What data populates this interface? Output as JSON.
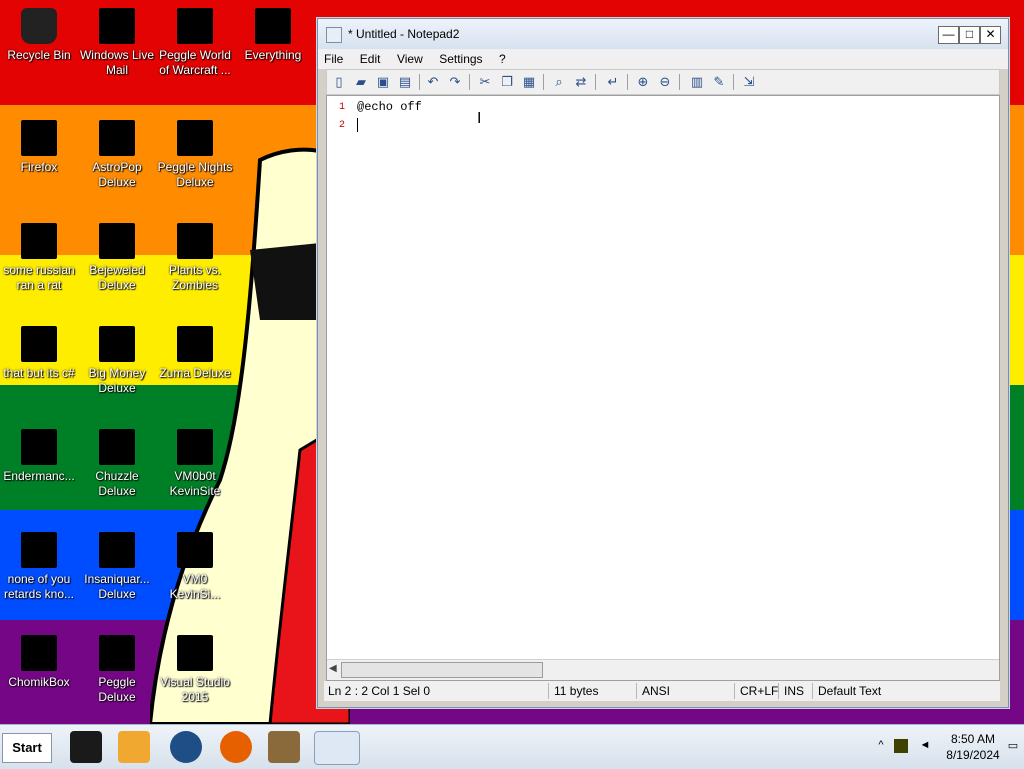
{
  "desktop": {
    "icons": [
      {
        "label": "Recycle Bin"
      },
      {
        "label": "Windows Live Mail"
      },
      {
        "label": "Peggle World of Warcraft ..."
      },
      {
        "label": "Everything"
      },
      {
        "label": "Firefox"
      },
      {
        "label": "AstroPop Deluxe"
      },
      {
        "label": "Peggle Nights Deluxe"
      },
      {
        "label": "some russian ran a rat"
      },
      {
        "label": "Bejeweled Deluxe"
      },
      {
        "label": "Plants vs. Zombies"
      },
      {
        "label": "that but its c#"
      },
      {
        "label": "Big Money Deluxe"
      },
      {
        "label": "Zuma Deluxe"
      },
      {
        "label": "Endermanc..."
      },
      {
        "label": "Chuzzle Deluxe"
      },
      {
        "label": "VM0b0t KevinSite"
      },
      {
        "label": "none of you retards kno..."
      },
      {
        "label": "Insaniquar... Deluxe"
      },
      {
        "label": "VM0 KevinSi..."
      },
      {
        "label": "ChomikBox"
      },
      {
        "label": "Peggle Deluxe"
      },
      {
        "label": "Visual Studio 2015"
      }
    ]
  },
  "window": {
    "title": "* Untitled - Notepad2",
    "controls": {
      "minimize": "—",
      "maximize": "□",
      "close": "✕"
    },
    "menu": [
      "File",
      "Edit",
      "View",
      "Settings",
      "?"
    ],
    "editor": {
      "line_numbers": [
        "1",
        "2"
      ],
      "lines": [
        "@echo off",
        ""
      ]
    },
    "status": {
      "position": "Ln 2 : 2    Col 1    Sel 0",
      "size": "11 bytes",
      "encoding": "ANSI",
      "eol": "CR+LF",
      "mode": "INS",
      "scheme": "Default Text"
    }
  },
  "taskbar": {
    "start_label": "Start",
    "clock_time": "8:50 AM",
    "clock_date": "8/19/2024"
  },
  "colors": {
    "rainbow": [
      "#e40303",
      "#ff8c00",
      "#ffed00",
      "#008026",
      "#004dff",
      "#750787"
    ]
  }
}
